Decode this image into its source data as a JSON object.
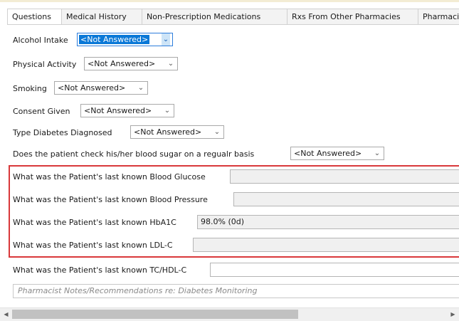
{
  "tabs": [
    {
      "label": "Questions"
    },
    {
      "label": "Medical History"
    },
    {
      "label": "Non-Prescription Medications"
    },
    {
      "label": "Rxs From Other Pharmacies"
    },
    {
      "label": "Pharmacis"
    }
  ],
  "fields": {
    "alcohol": {
      "label": "Alcohol Intake",
      "value": "<Not Answered>"
    },
    "activity": {
      "label": "Physical Activity",
      "value": "<Not Answered>"
    },
    "smoking": {
      "label": "Smoking",
      "value": "<Not Answered>"
    },
    "consent": {
      "label": "Consent Given",
      "value": "<Not Answered>"
    },
    "diabetes_type": {
      "label": "Type Diabetes Diagnosed",
      "value": "<Not Answered>"
    },
    "sugar_check": {
      "label": "Does the patient check his/her blood sugar on a regualr basis",
      "value": "<Not Answered>"
    },
    "glucose": {
      "label": "What was the Patient's last known Blood Glucose",
      "value": ""
    },
    "pressure": {
      "label": "What was the Patient's last known Blood Pressure",
      "value": ""
    },
    "hba1c": {
      "label": "What was the Patient's last known HbA1C",
      "value": "98.0% (0d)"
    },
    "ldl": {
      "label": "What was the Patient's last known LDL-C",
      "value": ""
    },
    "tchdl": {
      "label": "What was the Patient's last known TC/HDL-C",
      "value": ""
    }
  },
  "notes": {
    "placeholder": "Pharmacist Notes/Recommendations re: Diabetes Monitoring"
  },
  "icons": {
    "dropdown": "chevron-down-icon",
    "scroll_left": "triangle-left-icon",
    "scroll_right": "triangle-right-icon"
  },
  "colors": {
    "highlight_border": "#d9383a",
    "focus_blue": "#0a78d7"
  }
}
